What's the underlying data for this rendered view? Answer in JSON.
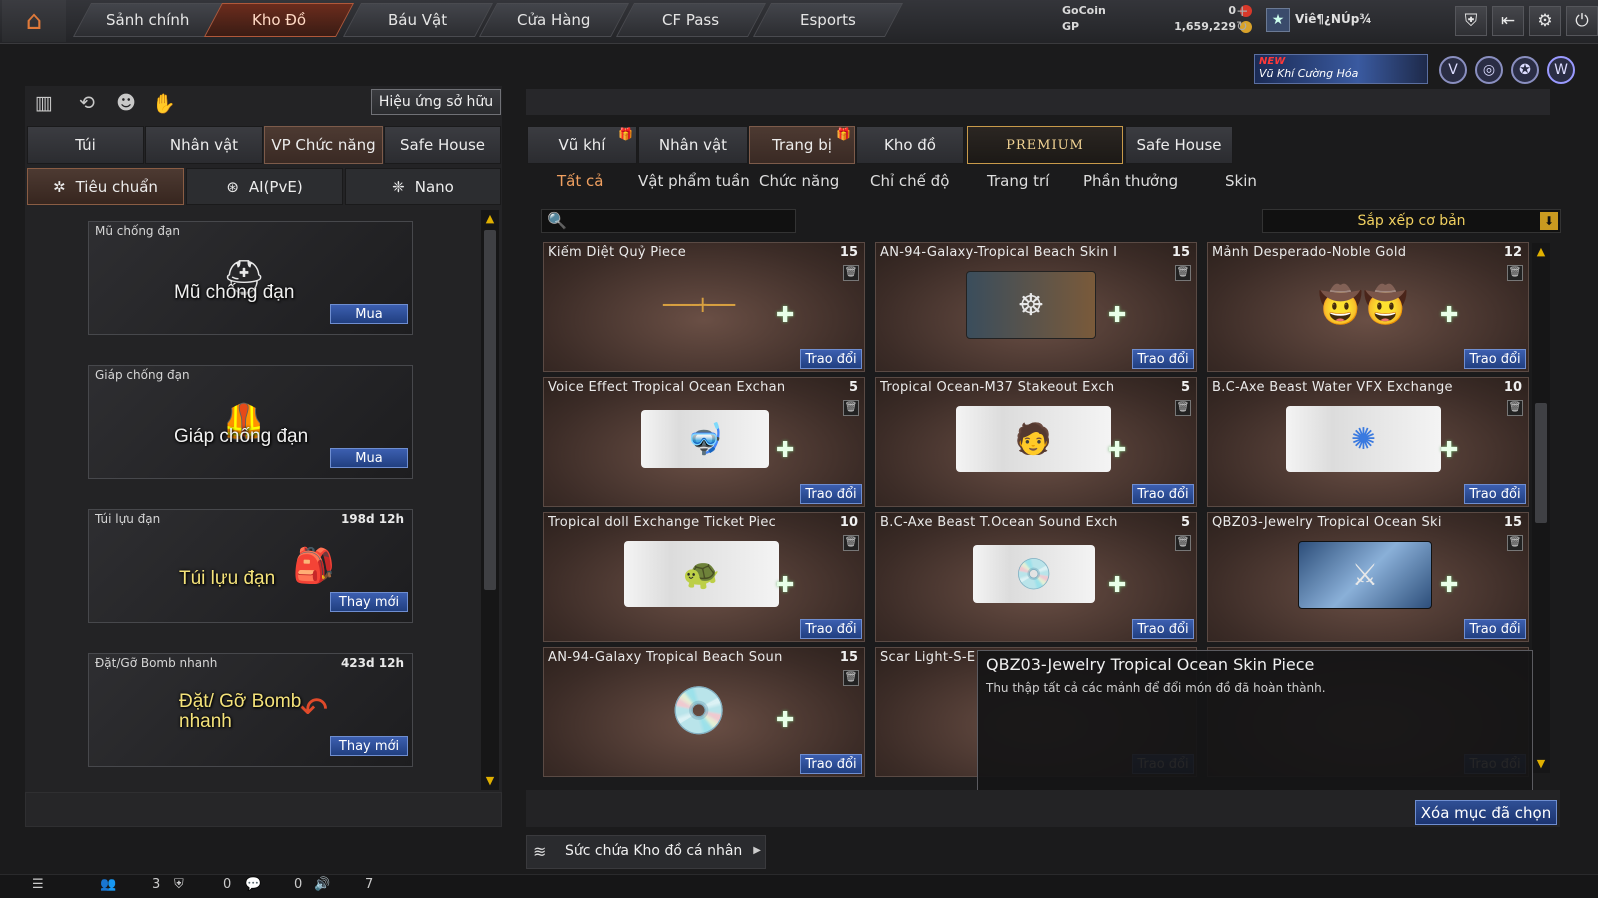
{
  "nav": {
    "tabs": [
      "Sảnh chính",
      "Kho Đồ",
      "Báu Vật",
      "Cửa Hàng",
      "CF Pass",
      "Esports"
    ],
    "active_index": 1
  },
  "currency": {
    "gocoin_label": "GoCoin",
    "gocoin_value": "0",
    "gp_label": "GP",
    "gp_value": "1,659,229"
  },
  "user": {
    "name": "Viê¶¿NÚp¾"
  },
  "banner": {
    "new_label": "NEW",
    "text": "Vũ Khí Cường Hóa"
  },
  "left": {
    "effect_button": "Hiệu ứng sở hữu",
    "tabs": [
      "Túi",
      "Nhân vật",
      "VP Chức năng",
      "Safe House"
    ],
    "active_tab": 2,
    "subtabs": [
      "Tiêu chuẩn",
      "AI(PvE)",
      "Nano"
    ],
    "items": [
      {
        "title": "Mũ chống đạn",
        "time": "",
        "image_label": "Mũ chống đạn",
        "button": "Mua"
      },
      {
        "title": "Giáp chống đạn",
        "time": "",
        "image_label": "Giáp chống đạn",
        "button": "Mua"
      },
      {
        "title": "Túi lựu đạn",
        "time": "198d 12h",
        "image_label": "Túi lựu đạn",
        "button": "Thay mới"
      },
      {
        "title": "Đặt/Gỡ Bomb nhanh",
        "time": "423d 12h",
        "image_label": "Đặt/ Gỡ Bomb nhanh",
        "button": "Thay mới"
      }
    ]
  },
  "right": {
    "tabs": [
      "Vũ khí",
      "Nhân vật",
      "Trang bị",
      "Kho đồ",
      "PREMIUM",
      "Safe House"
    ],
    "active_tab": 2,
    "subtabs": [
      "Tất cả",
      "Vật phẩm tuần",
      "Chức năng",
      "Chỉ chế độ",
      "Trang trí",
      "Phần thưởng",
      "Skin"
    ],
    "active_subtab": 0,
    "search_placeholder": "",
    "sort_label": "Sắp xếp cơ bản",
    "trade_label": "Trao đổi",
    "cards": [
      {
        "title": "Kiếm Diệt Quỷ Piece",
        "count": "15"
      },
      {
        "title": "AN-94-Galaxy-Tropical Beach Skin I",
        "count": "15"
      },
      {
        "title": "Mảnh Desperado-Noble Gold",
        "count": "12"
      },
      {
        "title": "Voice Effect Tropical Ocean Exchan",
        "count": "5"
      },
      {
        "title": "Tropical Ocean-M37 Stakeout Exch",
        "count": "5"
      },
      {
        "title": "B.C-Axe Beast Water VFX Exchange ",
        "count": "10"
      },
      {
        "title": "Tropical doll Exchange Ticket Piec",
        "count": "10"
      },
      {
        "title": "B.C-Axe Beast T.Ocean Sound Exch",
        "count": "5"
      },
      {
        "title": "QBZ03-Jewelry Tropical Ocean Ski",
        "count": "15"
      },
      {
        "title": "AN-94-Galaxy Tropical Beach Soun",
        "count": "15"
      },
      {
        "title": "Scar Light-S-E",
        "count": ""
      },
      {
        "title": "",
        "count": ""
      }
    ],
    "tooltip": {
      "title": "QBZ03-Jewelry Tropical Ocean Skin Piece",
      "desc": "Thu thập tất cả các mảnh để đổi món đồ đã hoàn thành."
    },
    "delete_button": "Xóa mục đã chọn",
    "capacity_label": "Sức chứa Kho đồ cá nhân"
  },
  "status": {
    "count1": "3",
    "count2": "0",
    "count3": "0",
    "count4": "7"
  },
  "colors": {
    "accent": "#e07a3a",
    "button_blue": "#2f4f95",
    "gold": "#f0d060"
  }
}
